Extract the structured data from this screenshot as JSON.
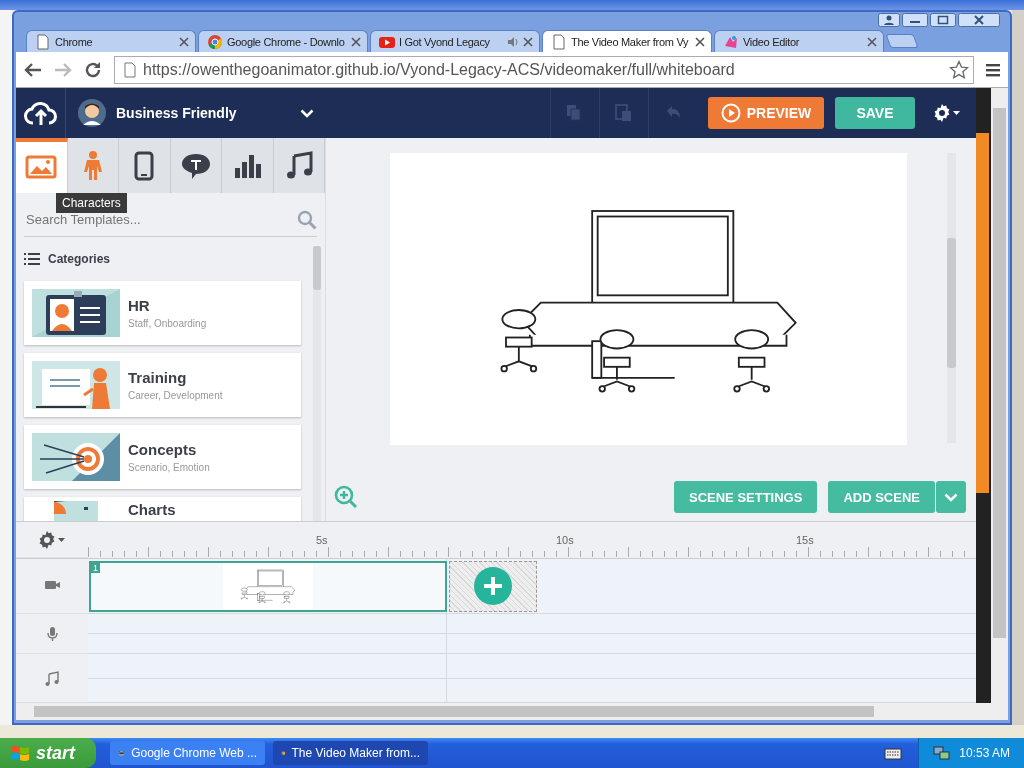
{
  "browser": {
    "tabs": [
      {
        "title": "Chrome",
        "kind": "page",
        "audio": false,
        "selected": false
      },
      {
        "title": "Google Chrome - Downlo",
        "kind": "chrome",
        "audio": false,
        "selected": false
      },
      {
        "title": "I Got Vyond Legacy",
        "kind": "video",
        "audio": true,
        "selected": false
      },
      {
        "title": "The Video Maker from Vy",
        "kind": "page",
        "audio": false,
        "selected": true
      },
      {
        "title": "Video Editor",
        "kind": "app",
        "audio": false,
        "selected": false
      }
    ],
    "address": "https://owenthegoanimator.github.io/Vyond-Legacy-ACS/videomaker/full/whiteboard"
  },
  "app": {
    "theme": "Business Friendly",
    "asset_tabs": [
      {
        "kind": "image",
        "selected": true
      },
      {
        "kind": "character",
        "selected": false
      },
      {
        "kind": "phone",
        "selected": false
      },
      {
        "kind": "text",
        "selected": false
      },
      {
        "kind": "chart",
        "selected": false
      },
      {
        "kind": "music",
        "selected": false
      }
    ],
    "tooltip": "Characters",
    "search": {
      "placeholder": "Search Templates..."
    },
    "categories_heading": "Categories",
    "categories": [
      {
        "name": "HR",
        "subtitle": "Staff, Onboarding",
        "kind": "badge"
      },
      {
        "name": "Training",
        "subtitle": "Career, Development",
        "kind": "presenter"
      },
      {
        "name": "Concepts",
        "subtitle": "Scenario, Emotion",
        "kind": "target"
      },
      {
        "name": "Charts",
        "kind": "chart"
      }
    ],
    "toolbar": {
      "actions": [
        {
          "kind": "copy",
          "disabled": true
        },
        {
          "kind": "paste",
          "disabled": true
        },
        {
          "kind": "undo",
          "disabled": true
        }
      ],
      "preview": "PREVIEW",
      "save": "SAVE"
    },
    "stage": {
      "scene_settings": "SCENE SETTINGS",
      "add_scene": "ADD SCENE"
    },
    "timeline": {
      "ticks": [
        "5s",
        "10s",
        "15s"
      ],
      "tracks": [
        {
          "kind": "video"
        },
        {
          "kind": "voice"
        },
        {
          "kind": "music"
        }
      ],
      "scenes": [
        {
          "number": "1",
          "selected": true
        }
      ]
    }
  },
  "taskbar": {
    "start": "start",
    "tasks": [
      {
        "label": "Google Chrome Web ...",
        "kind": "raccoon",
        "selected": false
      },
      {
        "label": "The Video Maker from...",
        "kind": "chrome",
        "selected": true
      }
    ],
    "clock": "10:53 AM"
  }
}
